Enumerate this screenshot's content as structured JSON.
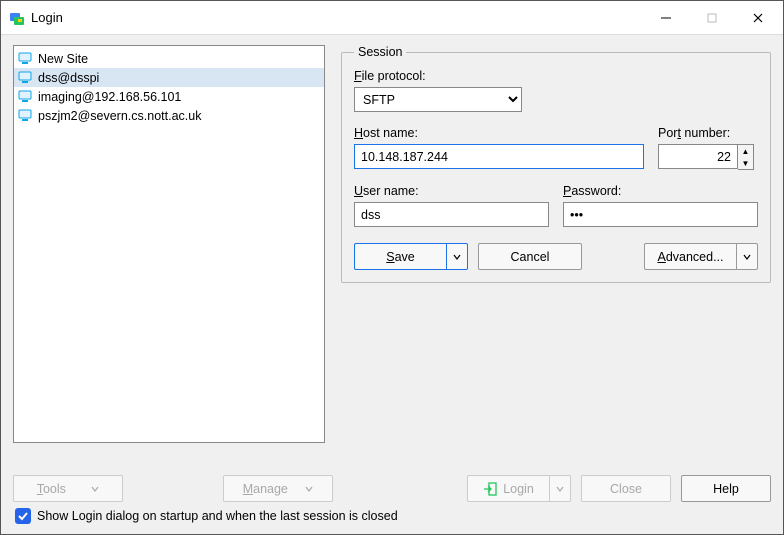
{
  "window": {
    "title": "Login"
  },
  "sites": {
    "items": [
      {
        "label": "New Site"
      },
      {
        "label": "dss@dsspi"
      },
      {
        "label": "imaging@192.168.56.101"
      },
      {
        "label": "pszjm2@severn.cs.nott.ac.uk"
      }
    ]
  },
  "session": {
    "legend": "Session",
    "file_protocol_label_pre": "F",
    "file_protocol_label_post": "ile protocol:",
    "file_protocol_value": "SFTP",
    "host_label_pre": "H",
    "host_label_post": "ost name:",
    "host_value": "10.148.187.244",
    "port_label_pre": "Por",
    "port_label_mid": "t",
    "port_label_post": " number:",
    "port_value": "22",
    "user_label_pre": "U",
    "user_label_post": "ser name:",
    "user_value": "dss",
    "password_label_pre": "P",
    "password_label_post": "assword:",
    "password_value": "•••",
    "save_pre": "S",
    "save_post": "ave",
    "cancel": "Cancel",
    "advanced_pre": "A",
    "advanced_post": "dvanced..."
  },
  "bottom": {
    "tools_pre": "T",
    "tools_post": "ools",
    "manage_pre": "M",
    "manage_post": "anage",
    "login": "Login",
    "close": "Close",
    "help": "Help",
    "checkbox_label": "Show Login dialog on startup and when the last session is closed"
  }
}
